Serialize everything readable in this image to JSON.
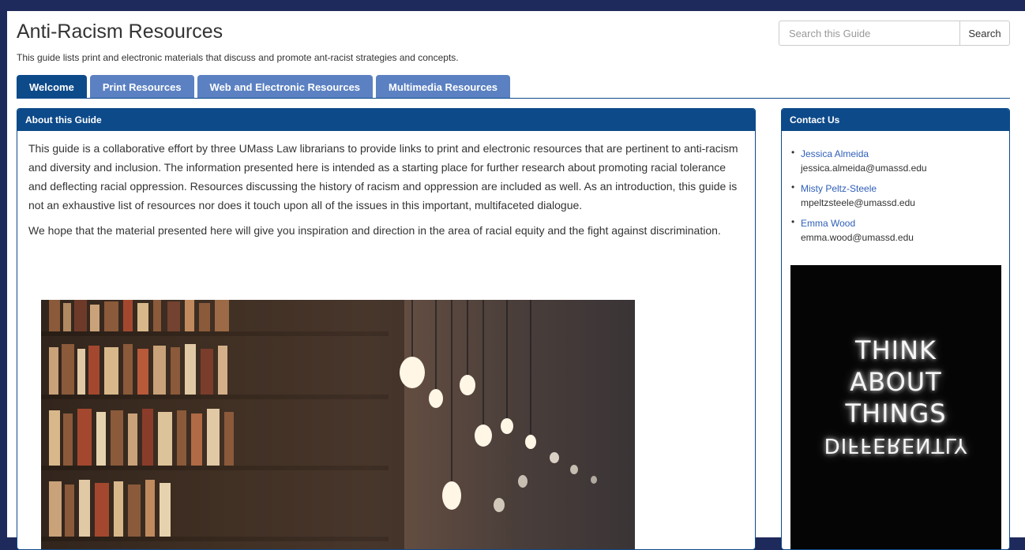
{
  "header": {
    "title": "Anti-Racism Resources",
    "subtitle": "This guide lists print and electronic materials that discuss and promote ant-racist strategies and concepts."
  },
  "search": {
    "placeholder": "Search this Guide",
    "button_label": "Search"
  },
  "tabs": [
    {
      "label": "Welcome",
      "active": true
    },
    {
      "label": "Print Resources",
      "active": false
    },
    {
      "label": "Web and Electronic Resources",
      "active": false
    },
    {
      "label": "Multimedia Resources",
      "active": false
    }
  ],
  "about": {
    "heading": "About this Guide",
    "paragraphs": [
      "This guide is a collaborative effort by three UMass Law librarians to provide links to print and electronic resources that are pertinent to anti-racism and diversity and inclusion. The information presented here is intended as a starting place for further research about promoting racial tolerance and deflecting racial oppression.  Resources discussing the history of racism and oppression are included as well.  As an introduction, this guide is not an exhaustive list of resources nor does it touch upon all of the issues in this important, multifaceted dialogue.",
      "We hope that the material presented here will give you inspiration and direction in the area of racial equity and the fight against discrimination."
    ]
  },
  "contact": {
    "heading": "Contact Us",
    "people": [
      {
        "name": "Jessica Almeida",
        "email": "jessica.almeida@umassd.edu"
      },
      {
        "name": "Misty Peltz-Steele",
        "email": "mpeltzsteele@umassd.edu"
      },
      {
        "name": "Emma Wood",
        "email": "emma.wood@umassd.edu"
      }
    ],
    "neon_sign": {
      "lines": [
        "THINK",
        "ABOUT",
        "THINGS",
        "DIFFERENTLY"
      ]
    }
  },
  "colors": {
    "page_frame": "#1f2a5c",
    "panel_header": "#0d4a8a",
    "tab_inactive": "#5b81c2",
    "link": "#2f5fb8"
  }
}
